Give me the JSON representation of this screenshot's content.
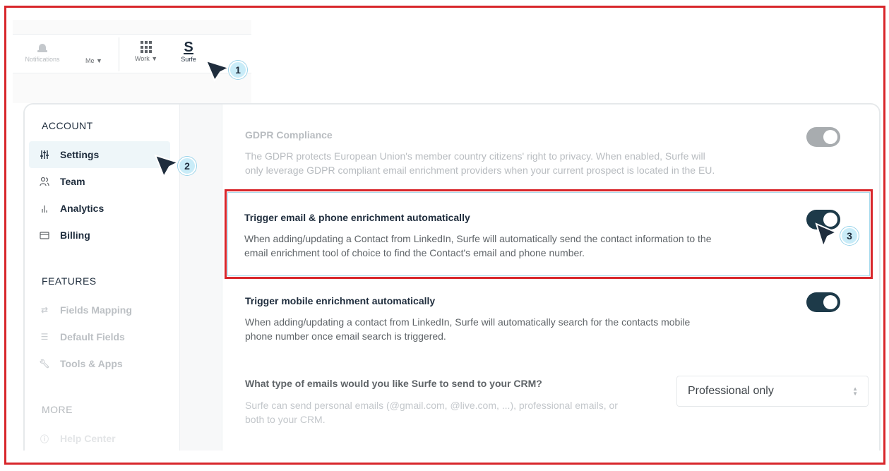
{
  "topnav": {
    "notifications": "Notifications",
    "me": "Me ▼",
    "work": "Work ▼",
    "surfe_logo": "S",
    "surfe": "Surfe"
  },
  "sidebar": {
    "account_title": "ACCOUNT",
    "account_items": [
      {
        "label": "Settings",
        "icon": "sliders-icon"
      },
      {
        "label": "Team",
        "icon": "users-icon"
      },
      {
        "label": "Analytics",
        "icon": "bar-chart-icon"
      },
      {
        "label": "Billing",
        "icon": "card-icon"
      }
    ],
    "features_title": "FEATURES",
    "features_items": [
      {
        "label": "Fields Mapping",
        "icon": "swap-icon"
      },
      {
        "label": "Default Fields",
        "icon": "list-icon"
      },
      {
        "label": "Tools & Apps",
        "icon": "wrench-icon"
      }
    ],
    "more_title": "MORE",
    "more_items": [
      {
        "label": "Help Center",
        "icon": "help-icon"
      }
    ]
  },
  "settings": {
    "gdpr": {
      "title": "GDPR Compliance",
      "desc_line1": "The GDPR protects European Union's member country citizens' right to privacy. When enabled, Surfe will",
      "desc_line2": "only leverage GDPR compliant email enrichment providers when your current prospect is located in the EU.",
      "enabled": true
    },
    "email_phone": {
      "title": "Trigger email & phone enrichment automatically",
      "desc_line1": "When adding/updating a Contact from LinkedIn, Surfe will automatically send the contact information to the",
      "desc_line2": "email enrichment tool of choice to find the Contact's email and phone number.",
      "enabled": true
    },
    "mobile": {
      "title": "Trigger mobile enrichment automatically",
      "desc_line1": "When adding/updating a contact from LinkedIn, Surfe will automatically search for the contacts mobile",
      "desc_line2": "phone number once email search is triggered.",
      "enabled": true
    },
    "email_type": {
      "title": "What type of emails would you like Surfe to send to your CRM?",
      "desc_line1": "Surfe can send personal emails (@gmail.com, @live.com, ...), professional emails, or",
      "desc_line2": "both to your CRM.",
      "selected": "Professional only"
    }
  },
  "callouts": [
    "1",
    "2",
    "3"
  ],
  "colors": {
    "accent_red": "#d8262b",
    "toggle_on": "#1d3a49",
    "badge_bg": "#c9ecf8"
  }
}
